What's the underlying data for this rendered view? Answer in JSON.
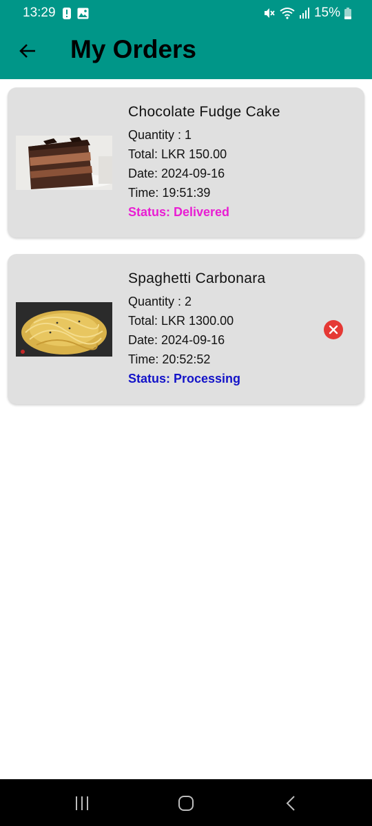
{
  "status_bar": {
    "time": "13:29",
    "battery": "15%"
  },
  "appbar": {
    "title": "My Orders",
    "back_icon": "arrow-left-icon",
    "background": "#009688"
  },
  "orders": [
    {
      "name": "Chocolate Fudge Cake",
      "quantity": "Quantity : 1",
      "total": "Total: LKR 150.00",
      "date": "Date: 2024-09-16",
      "time": "Time: 19:51:39",
      "status": "Status: Delivered",
      "status_color": "#e91ed3",
      "image": "chocolate-cake-image"
    },
    {
      "name": "Spaghetti Carbonara",
      "quantity": "Quantity : 2",
      "total": "Total: LKR 1300.00",
      "date": "Date: 2024-09-16",
      "time": "Time: 20:52:52",
      "status": "Status: Processing",
      "status_color": "#1313c8",
      "image": "spaghetti-image",
      "cancel_icon": "cancel-circle-icon"
    }
  ],
  "nav": {
    "recents_icon": "recents-icon",
    "home_icon": "home-icon",
    "back_icon": "back-chevron-icon"
  }
}
